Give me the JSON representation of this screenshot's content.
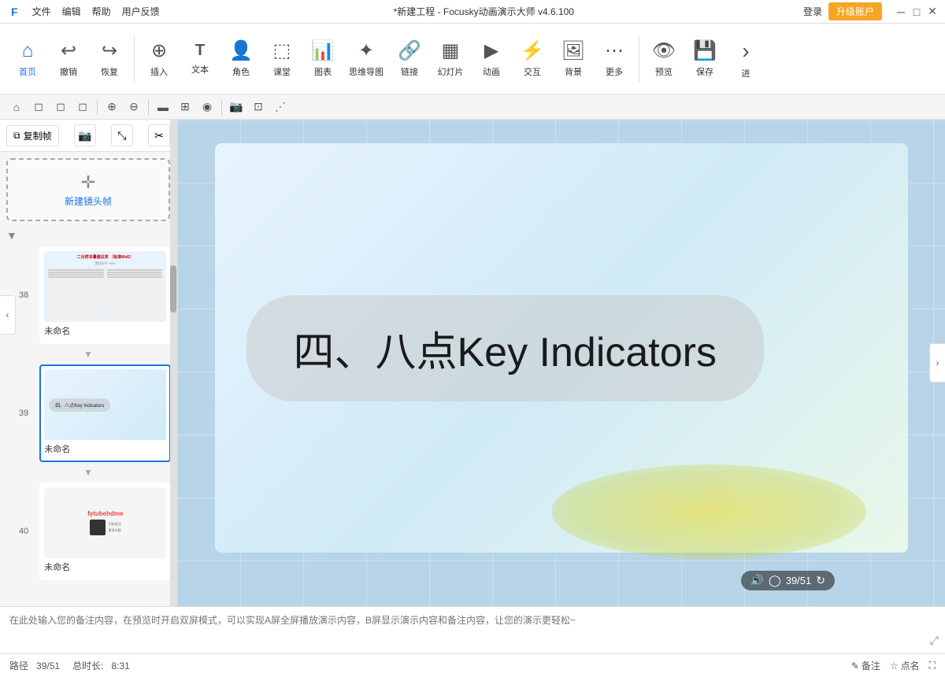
{
  "app": {
    "logo": "F",
    "title": "*新建工程 - Focusky动画演示大师  v4.6.100",
    "login_label": "登录",
    "upgrade_label": "升级账户"
  },
  "menu": {
    "items": [
      "文件",
      "编辑",
      "帮助",
      "用户反馈"
    ]
  },
  "toolbar": {
    "items": [
      {
        "id": "home",
        "icon": "⌂",
        "label": "首页",
        "active": true
      },
      {
        "id": "undo",
        "icon": "↩",
        "label": "撤销"
      },
      {
        "id": "redo",
        "icon": "↪",
        "label": "恢复"
      },
      {
        "id": "insert",
        "icon": "⊕",
        "label": "插入"
      },
      {
        "id": "text",
        "icon": "T",
        "label": "文本"
      },
      {
        "id": "character",
        "icon": "☺",
        "label": "角色"
      },
      {
        "id": "classroom",
        "icon": "⬜",
        "label": "课堂"
      },
      {
        "id": "chart",
        "icon": "📊",
        "label": "图表"
      },
      {
        "id": "mindmap",
        "icon": "✦",
        "label": "思维导图"
      },
      {
        "id": "link",
        "icon": "🔗",
        "label": "链接"
      },
      {
        "id": "slides",
        "icon": "▦",
        "label": "幻灯片"
      },
      {
        "id": "animation",
        "icon": "▶",
        "label": "动画"
      },
      {
        "id": "interact",
        "icon": "⚡",
        "label": "交互"
      },
      {
        "id": "background",
        "icon": "🖼",
        "label": "背景"
      },
      {
        "id": "more",
        "icon": "…",
        "label": "更多"
      },
      {
        "id": "preview",
        "icon": "👁",
        "label": "预览"
      },
      {
        "id": "save",
        "icon": "💾",
        "label": "保存"
      },
      {
        "id": "next",
        "icon": "›",
        "label": "进"
      }
    ]
  },
  "toolbar2": {
    "icons": [
      "⌂",
      "◻",
      "◻",
      "◻",
      "◻",
      "⊕",
      "⊖",
      "▬",
      "⊞",
      "◉",
      "⋯",
      "⊡",
      "⋰"
    ]
  },
  "slide_panel": {
    "copy_frame_label": "复制帧",
    "new_frame_label": "新建镜头帧",
    "slides": [
      {
        "number": 38,
        "name": "未命名",
        "active": false,
        "thumb_type": "text"
      },
      {
        "number": 39,
        "name": "未命名",
        "active": true,
        "thumb_type": "bubble"
      },
      {
        "number": 40,
        "name": "未命名",
        "active": false,
        "thumb_type": "qr"
      }
    ]
  },
  "canvas": {
    "main_text": "四、八点Key Indicators",
    "page_current": 39,
    "page_total": 51
  },
  "notes": {
    "placeholder": "在此处输入您的备注内容，在预览时开启双屏模式，可以实现A屏全屏播放演示内容，B屏显示演示内容和备注内容，让您的演示更轻松~"
  },
  "statusbar": {
    "path_label": "路径",
    "path_value": "39/51",
    "duration_label": "总时长:",
    "duration_value": "8:31",
    "notes_label": "备注",
    "pointname_label": "点名",
    "fullscreen_icon": "⛶"
  }
}
